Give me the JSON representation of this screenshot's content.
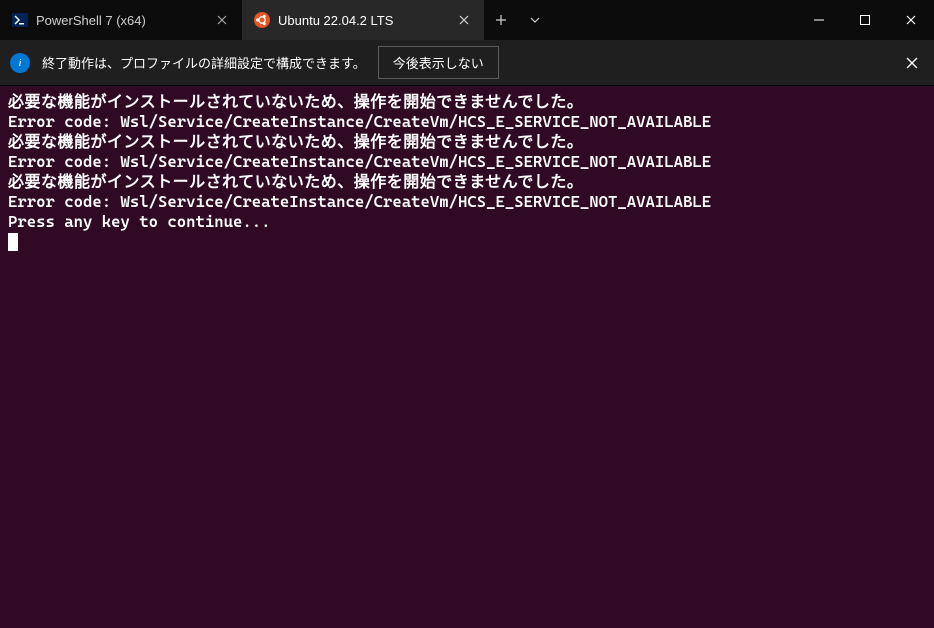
{
  "tabs": [
    {
      "label": "PowerShell 7 (x64)",
      "active": false
    },
    {
      "label": "Ubuntu 22.04.2 LTS",
      "active": true
    }
  ],
  "infobar": {
    "text": "終了動作は、プロファイルの詳細設定で構成できます。",
    "button": "今後表示しない"
  },
  "terminal": {
    "lines": [
      {
        "w": true,
        "t": "必要な機能がインストールされていないため、操作を開始できませんでした。"
      },
      {
        "w": false,
        "t": "Error code: Wsl/Service/CreateInstance/CreateVm/HCS_E_SERVICE_NOT_AVAILABLE"
      },
      {
        "w": true,
        "t": "必要な機能がインストールされていないため、操作を開始できませんでした。"
      },
      {
        "w": false,
        "t": "Error code: Wsl/Service/CreateInstance/CreateVm/HCS_E_SERVICE_NOT_AVAILABLE"
      },
      {
        "w": true,
        "t": "必要な機能がインストールされていないため、操作を開始できませんでした。"
      },
      {
        "w": false,
        "t": "Error code: Wsl/Service/CreateInstance/CreateVm/HCS_E_SERVICE_NOT_AVAILABLE"
      },
      {
        "w": false,
        "t": "Press any key to continue..."
      }
    ]
  }
}
